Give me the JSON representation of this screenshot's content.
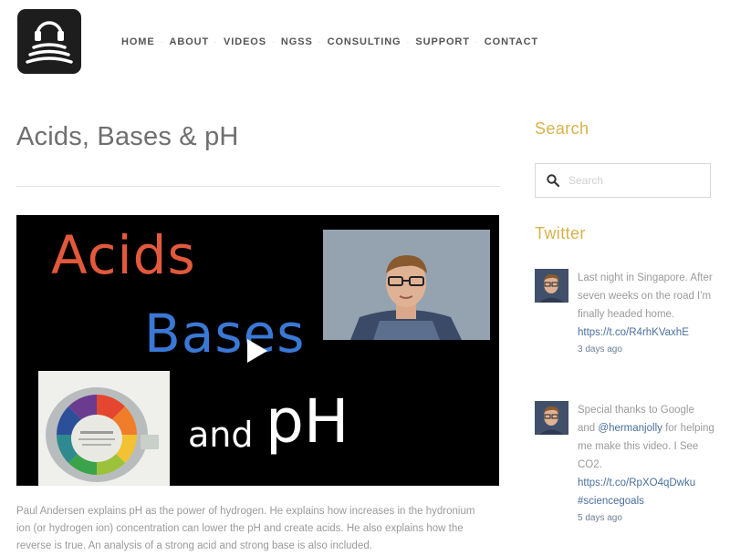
{
  "header": {
    "logo_icon": "headphones-waves-logo-icon",
    "nav": [
      "HOME",
      "ABOUT",
      "VIDEOS",
      "NGSS",
      "CONSULTING",
      "SUPPORT",
      "CONTACT"
    ]
  },
  "main": {
    "title": "Acids, Bases & pH",
    "video": {
      "words": [
        "Acids",
        "Bases",
        "and",
        "pH"
      ],
      "play_icon": "play-icon"
    },
    "description": "Paul Andersen explains pH as the power of hydrogen. He explains how increases in the hydronium ion (or hydrogen ion) concentration can lower the pH and create acids. He also explains how the reverse is true. An analysis of a strong acid and strong base is also included."
  },
  "sidebar": {
    "search": {
      "title": "Search",
      "placeholder": "Search",
      "icon": "search-icon"
    },
    "twitter": {
      "title": "Twitter",
      "tweets": [
        {
          "text": "Last night in Singapore. After seven weeks on the road I'm finally headed home.",
          "link": "https://t.co/R4rhKVaxhE",
          "time": "3 days ago"
        },
        {
          "text_before": "Special thanks to Google and ",
          "mention": "@hermanjolly",
          "text_after": " for helping me make this video. I See CO2.",
          "link": "https://t.co/RpXO4qDwku",
          "hashtag": "#sciencegoals",
          "time": "5 days ago"
        }
      ]
    }
  },
  "colors": {
    "widget_title": "#d6b24b",
    "link": "#4a6f9c",
    "acids_word": "#e2593b",
    "bases_word": "#3a78d6"
  }
}
